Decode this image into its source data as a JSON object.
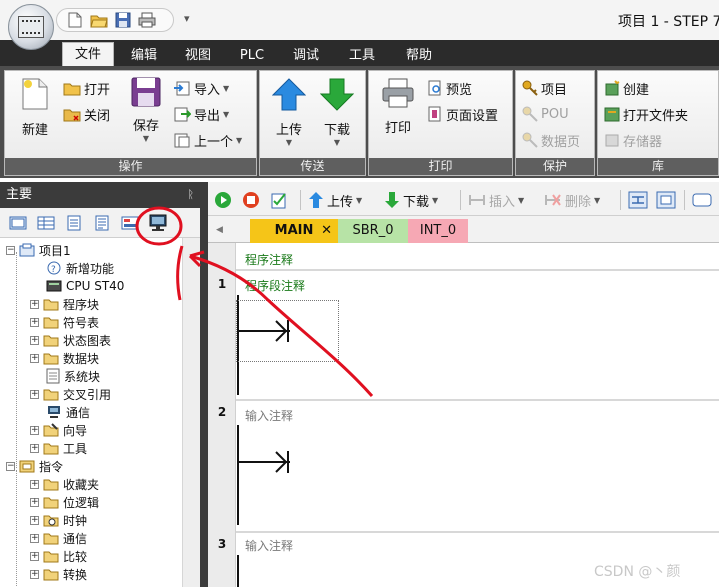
{
  "window": {
    "title": "项目 1 - STEP 7"
  },
  "quick_access": {
    "icons": [
      "new-file-icon",
      "open-folder-icon",
      "save-icon",
      "print-icon"
    ],
    "dropdown": "▾"
  },
  "menu": {
    "tabs": [
      {
        "label": "文件",
        "active": true
      },
      {
        "label": "编辑",
        "active": false
      },
      {
        "label": "视图",
        "active": false
      },
      {
        "label": "PLC",
        "active": false
      },
      {
        "label": "调试",
        "active": false
      },
      {
        "label": "工具",
        "active": false
      },
      {
        "label": "帮助",
        "active": false
      }
    ]
  },
  "ribbon": {
    "groups": {
      "operate": {
        "label": "操作",
        "new": "新建",
        "open": "打开",
        "close": "关闭",
        "save": "保存",
        "import": "导入",
        "export": "导出",
        "previous": "上一个"
      },
      "transfer": {
        "label": "传送",
        "upload": "上传",
        "download": "下载"
      },
      "print": {
        "label": "打印",
        "print": "打印",
        "preview": "预览",
        "page_setup": "页面设置"
      },
      "protect": {
        "label": "保护",
        "project": "项目",
        "pou": "POU",
        "data_page": "数据页"
      },
      "library": {
        "label": "库",
        "create": "创建",
        "open_folder": "打开文件夹",
        "memory": "存储器"
      }
    }
  },
  "left_panel": {
    "header": "主要",
    "pin": "ᚱ",
    "toolbar_icons": [
      "view-icon-1",
      "view-icon-2",
      "view-icon-3",
      "view-icon-4",
      "view-icon-5",
      "communication-icon"
    ],
    "tree": [
      {
        "label": "项目1"
      },
      {
        "label": "新增功能"
      },
      {
        "label": "CPU ST40"
      },
      {
        "label": "程序块"
      },
      {
        "label": "符号表"
      },
      {
        "label": "状态图表"
      },
      {
        "label": "数据块"
      },
      {
        "label": "系统块"
      },
      {
        "label": "交叉引用"
      },
      {
        "label": "通信"
      },
      {
        "label": "向导"
      },
      {
        "label": "工具"
      },
      {
        "label": "指令"
      },
      {
        "label": "收藏夹"
      },
      {
        "label": "位逻辑"
      },
      {
        "label": "时钟"
      },
      {
        "label": "通信"
      },
      {
        "label": "比较"
      },
      {
        "label": "转换"
      }
    ]
  },
  "editor": {
    "toolbar": {
      "upload": "上传",
      "download": "下载",
      "insert": "插入",
      "delete": "删除"
    },
    "tabs": {
      "main": "MAIN",
      "main_close": "✕",
      "sbr": "SBR_0",
      "int": "INT_0"
    },
    "program_comment": "程序注释",
    "networks": [
      {
        "number": "1",
        "comment": "程序段注释"
      },
      {
        "number": "2",
        "comment": "输入注释"
      },
      {
        "number": "3",
        "comment": "输入注释"
      }
    ]
  },
  "colors": {
    "menu_bar": "#2b2b2b",
    "ribbon_bg": "#4d4d4d",
    "tab_main": "#f5c518",
    "tab_sbr": "#b7e3a6",
    "tab_int": "#f6a8b4",
    "comment_green": "#1a7a1a",
    "annotation_red": "#e01020"
  },
  "watermark": "CSDN @丶颜"
}
